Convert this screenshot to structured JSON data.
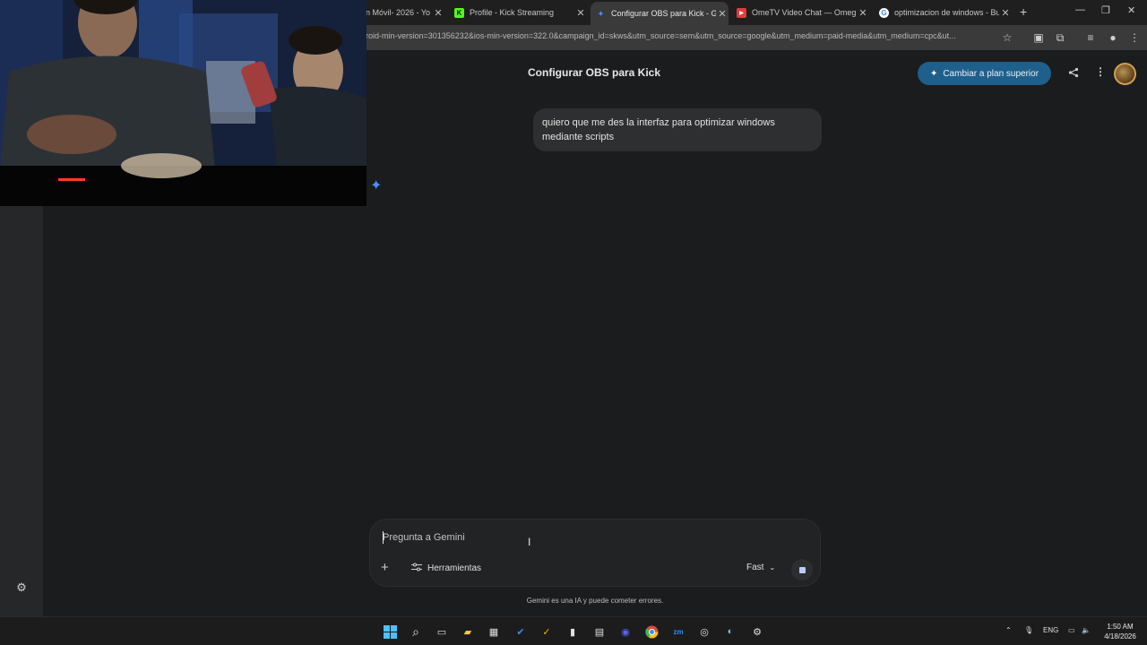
{
  "browser": {
    "tabs": [
      {
        "title": "n Móvil- 2026 - Yo",
        "favicon": "youtube-icon",
        "active": false
      },
      {
        "title": "Profile - Kick Streaming",
        "favicon": "kick-icon",
        "active": false
      },
      {
        "title": "Configurar OBS para Kick - Goo",
        "favicon": "gemini-icon",
        "active": true
      },
      {
        "title": "OmeTV Video Chat — Omegle",
        "favicon": "ometv-icon",
        "active": false
      },
      {
        "title": "optimizacion de windows - Bus",
        "favicon": "google-icon",
        "active": false
      }
    ],
    "url": "roid-min-version=301356232&ios-min-version=322.0&campaign_id=skws&utm_source=sem&utm_source=google&utm_medium=paid-media&utm_medium=cpc&ut..."
  },
  "header": {
    "conversation_title": "Configurar OBS para Kick",
    "upgrade_label": "Cambiar a plan superior"
  },
  "chat": {
    "user_message": "quiero que me des la interfaz para optimizar windows mediante scripts"
  },
  "composer": {
    "placeholder": "Pregunta a Gemini",
    "tools_label": "Herramientas",
    "model_label": "Fast"
  },
  "disclaimer": "Gemini es una IA y puede cometer errores.",
  "taskbar": {
    "language": "ENG",
    "time": "1:50 AM",
    "date": "4/18/2026"
  },
  "colors": {
    "accent": "#1f5f8b",
    "gemini_blue": "#4b8df8",
    "kick_green": "#53fc18"
  }
}
